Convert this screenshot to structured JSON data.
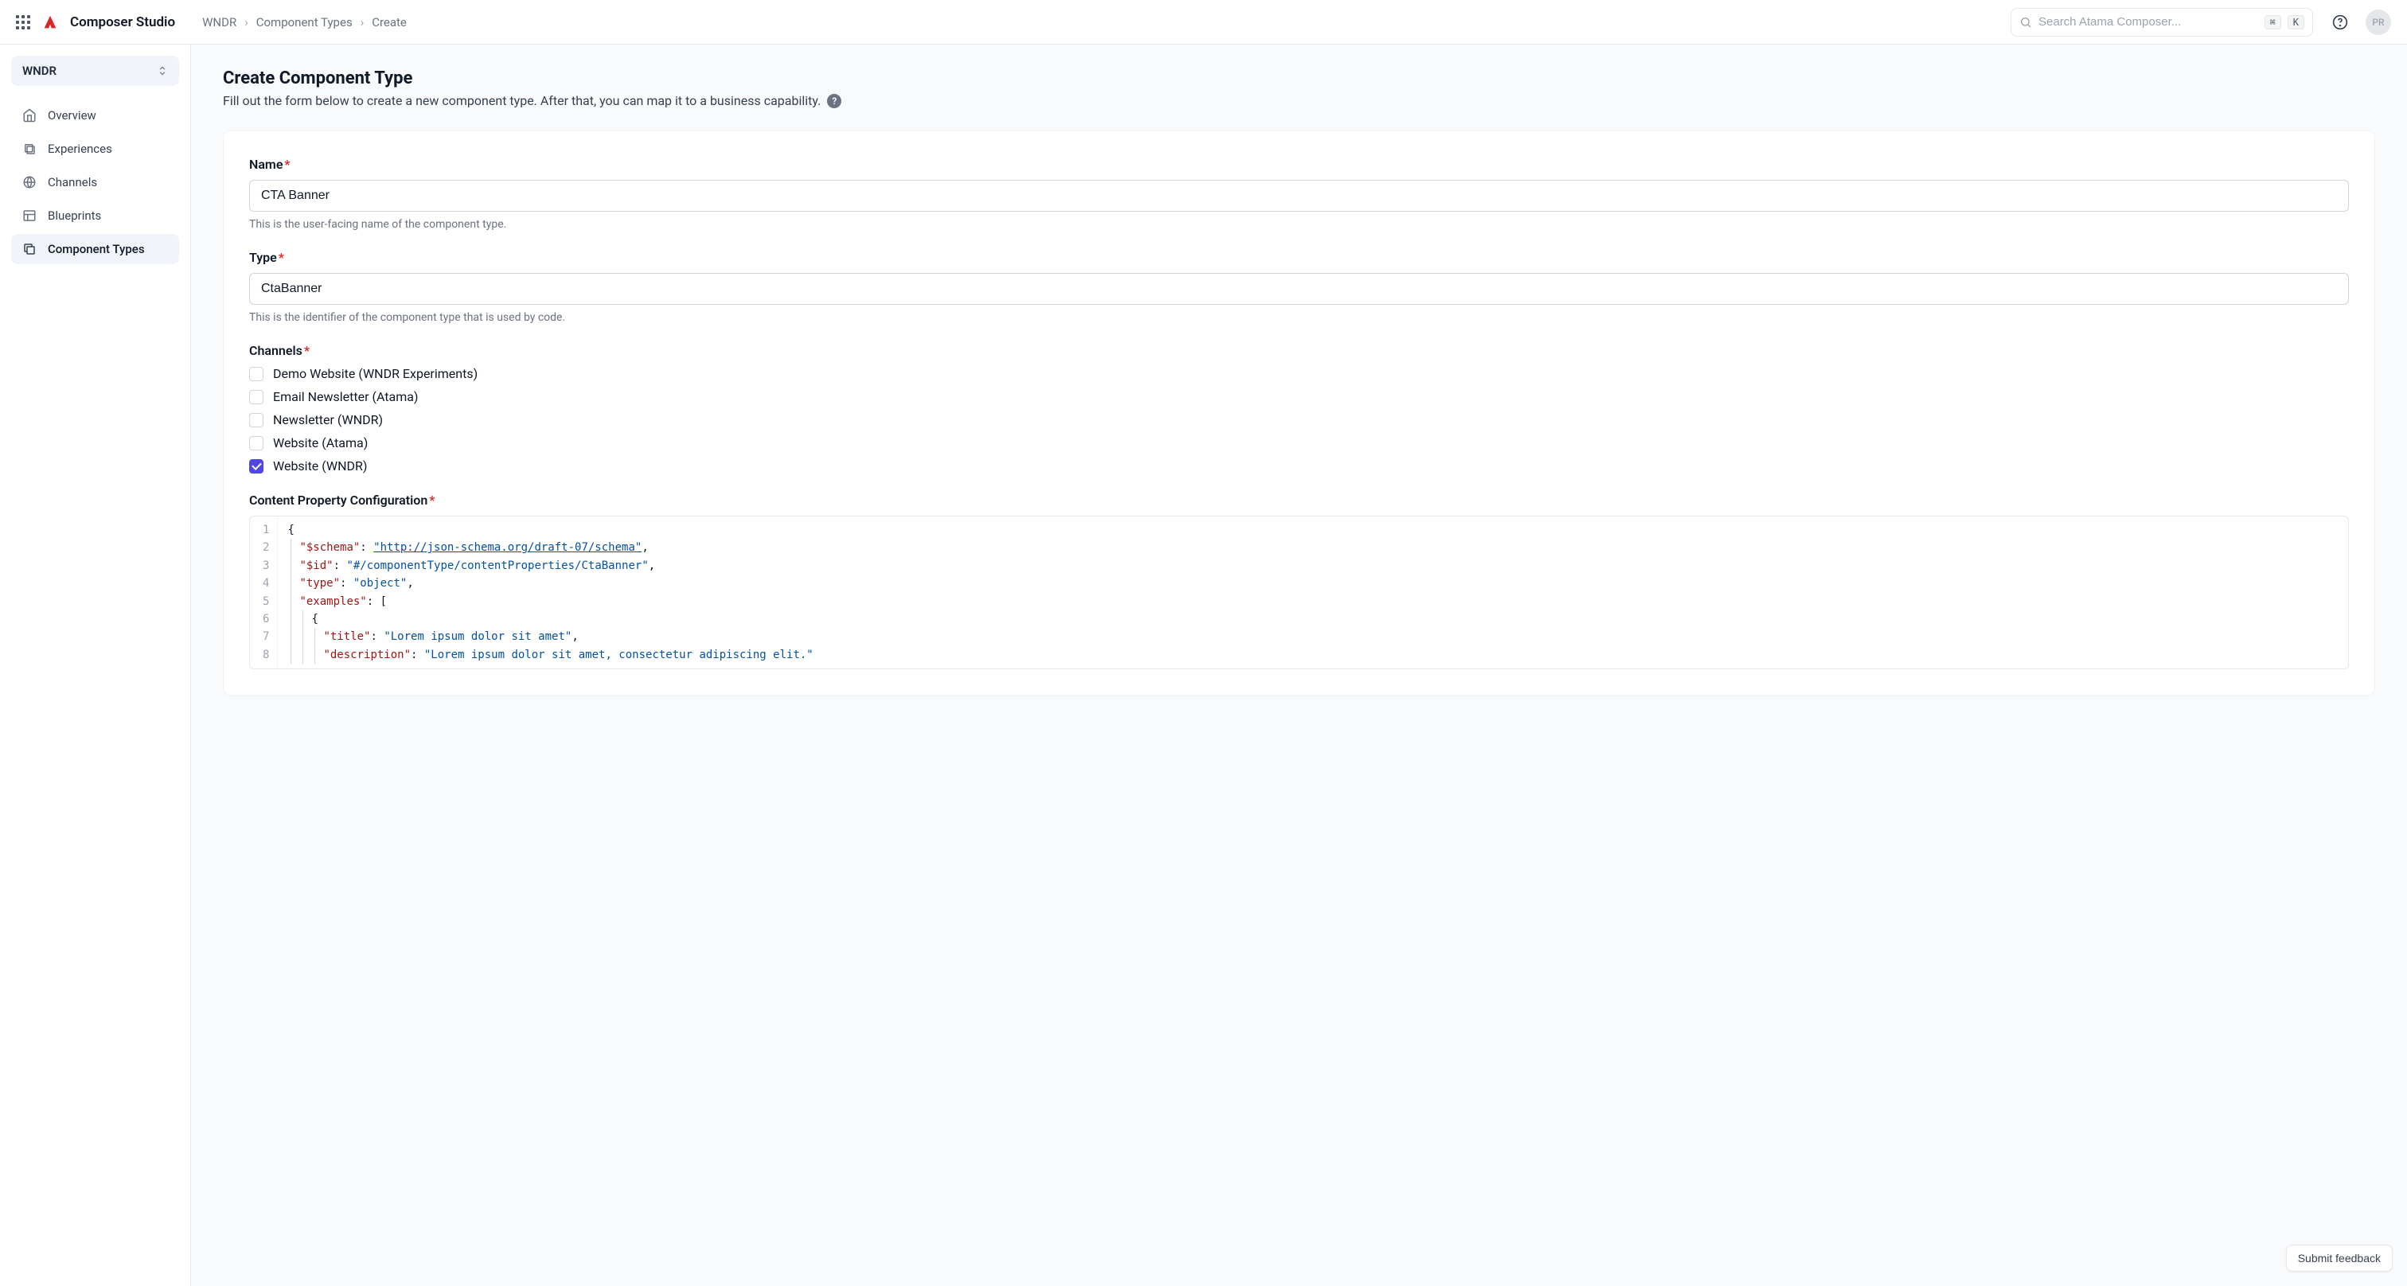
{
  "header": {
    "app_title": "Composer Studio",
    "search_placeholder": "Search Atama Composer...",
    "kbd1": "⌘",
    "kbd2": "K",
    "avatar_initials": "PR"
  },
  "breadcrumbs": [
    "WNDR",
    "Component Types",
    "Create"
  ],
  "sidebar": {
    "workspace": "WNDR",
    "items": [
      {
        "label": "Overview",
        "icon": "home",
        "active": false
      },
      {
        "label": "Experiences",
        "icon": "layers",
        "active": false
      },
      {
        "label": "Channels",
        "icon": "globe",
        "active": false
      },
      {
        "label": "Blueprints",
        "icon": "layout",
        "active": false
      },
      {
        "label": "Component Types",
        "icon": "copy",
        "active": true
      }
    ]
  },
  "page": {
    "title": "Create Component Type",
    "subtitle": "Fill out the form below to create a new component type. After that, you can map it to a business capability."
  },
  "form": {
    "name": {
      "label": "Name",
      "value": "CTA Banner",
      "help": "This is the user-facing name of the component type."
    },
    "type": {
      "label": "Type",
      "value": "CtaBanner",
      "help": "This is the identifier of the component type that is used by code."
    },
    "channels": {
      "label": "Channels",
      "options": [
        {
          "label": "Demo Website (WNDR Experiments)",
          "checked": false
        },
        {
          "label": "Email Newsletter (Atama)",
          "checked": false
        },
        {
          "label": "Newsletter (WNDR)",
          "checked": false
        },
        {
          "label": "Website (Atama)",
          "checked": false
        },
        {
          "label": "Website (WNDR)",
          "checked": true
        }
      ]
    },
    "config": {
      "label": "Content Property Configuration",
      "lines": [
        "1",
        "2",
        "3",
        "4",
        "5",
        "6",
        "7",
        "8"
      ],
      "schema_key": "\"$schema\"",
      "schema_val": "\"http://json-schema.org/draft-07/schema\"",
      "id_key": "\"$id\"",
      "id_val": "\"#/componentType/contentProperties/CtaBanner\"",
      "type_key": "\"type\"",
      "type_val": "\"object\"",
      "examples_key": "\"examples\"",
      "title_key": "\"title\"",
      "title_val": "\"Lorem ipsum dolor sit amet\"",
      "desc_key": "\"description\"",
      "desc_val": "\"Lorem ipsum dolor sit amet, consectetur adipiscing elit.\""
    }
  },
  "feedback_label": "Submit feedback"
}
